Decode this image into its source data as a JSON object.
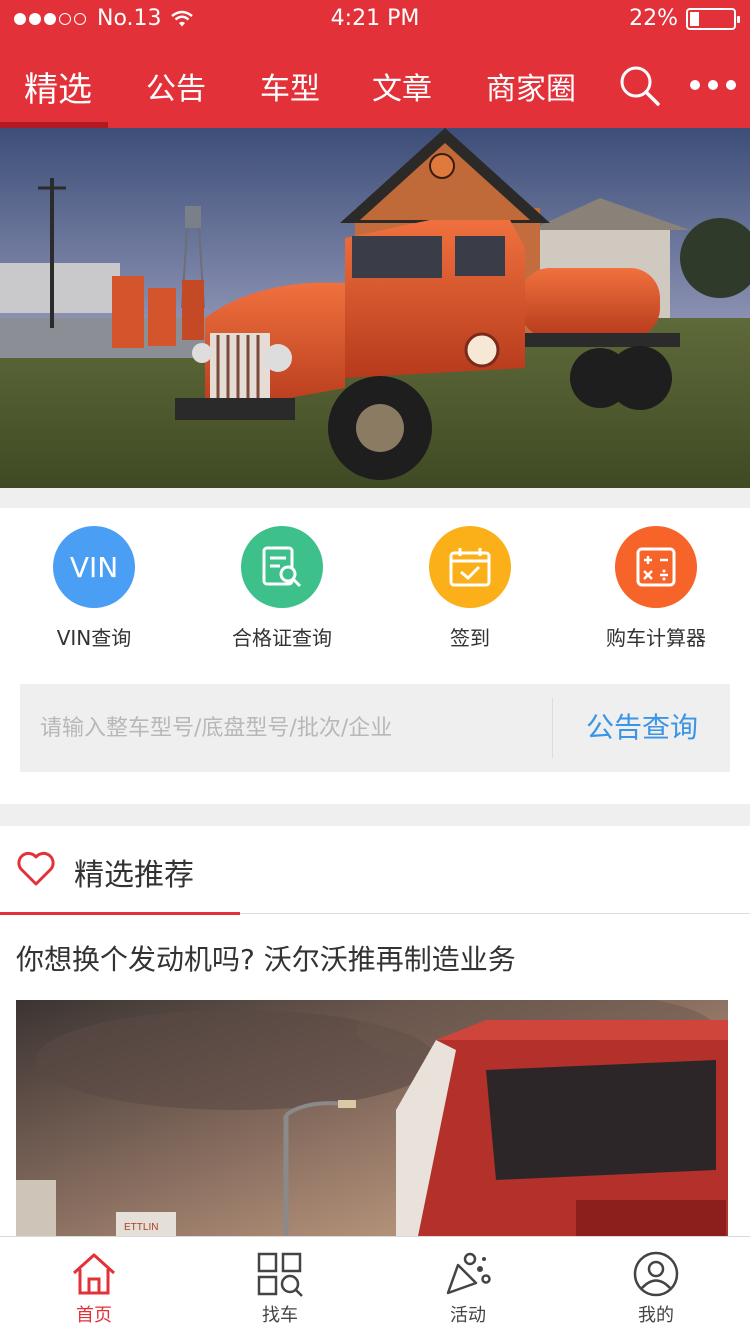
{
  "status_bar": {
    "carrier": "No.13",
    "time": "4:21 PM",
    "battery": "22%"
  },
  "top_tabs": [
    {
      "label": "精选",
      "active": true
    },
    {
      "label": "公告",
      "active": false
    },
    {
      "label": "车型",
      "active": false
    },
    {
      "label": "文章",
      "active": false
    },
    {
      "label": "商家圈",
      "active": false
    }
  ],
  "shortcuts": [
    {
      "label": "VIN查询",
      "icon_text": "VIN",
      "icon": "vin-icon",
      "color": "#4a9ef4"
    },
    {
      "label": "合格证查询",
      "icon": "certificate-search-icon",
      "color": "#3dc08a"
    },
    {
      "label": "签到",
      "icon": "calendar-check-icon",
      "color": "#fbb019"
    },
    {
      "label": "购车计算器",
      "icon": "calculator-icon",
      "color": "#f6642a"
    }
  ],
  "query": {
    "placeholder": "请输入整车型号/底盘型号/批次/企业",
    "button": "公告查询"
  },
  "recommend": {
    "title": "精选推荐",
    "article_title": "你想换个发动机吗? 沃尔沃推再制造业务"
  },
  "bottom_nav": [
    {
      "label": "首页",
      "icon": "home-icon",
      "active": true
    },
    {
      "label": "找车",
      "icon": "grid-search-icon",
      "active": false
    },
    {
      "label": "活动",
      "icon": "party-icon",
      "active": false
    },
    {
      "label": "我的",
      "icon": "user-icon",
      "active": false
    }
  ],
  "colors": {
    "brand_red": "#e3313a",
    "link_blue": "#3a95e6"
  }
}
